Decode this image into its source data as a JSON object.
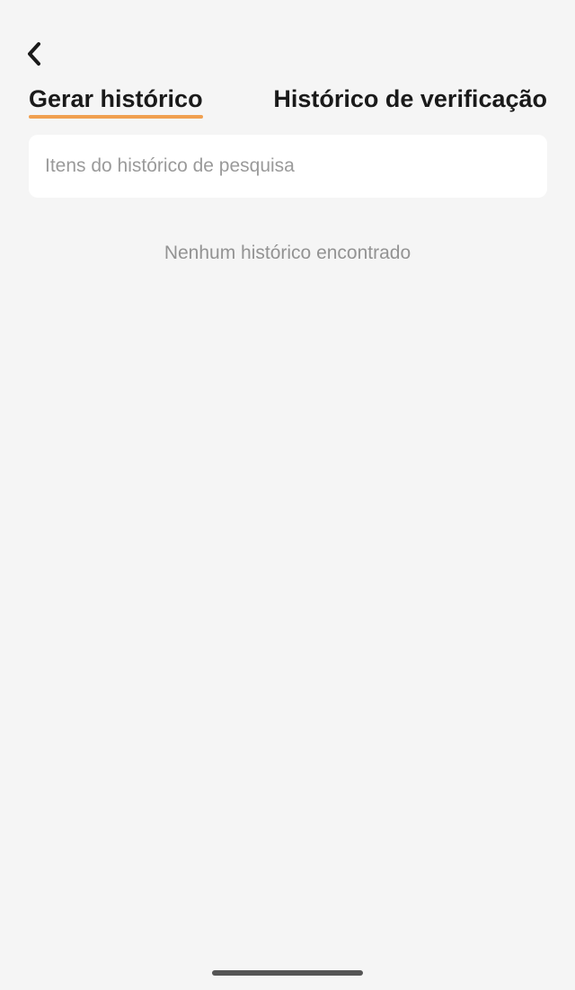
{
  "header": {
    "back_icon": "chevron-left-icon"
  },
  "tabs": [
    {
      "label": "Gerar histórico",
      "active": true
    },
    {
      "label": "Histórico de verificação",
      "active": false
    }
  ],
  "search": {
    "value": "",
    "placeholder": "Itens do histórico de pesquisa"
  },
  "empty_state": {
    "message": "Nenhum histórico encontrado"
  },
  "colors": {
    "background": "#f5f5f5",
    "accent": "#f0a050",
    "text_primary": "#1a1a1a",
    "text_muted": "#939393"
  }
}
